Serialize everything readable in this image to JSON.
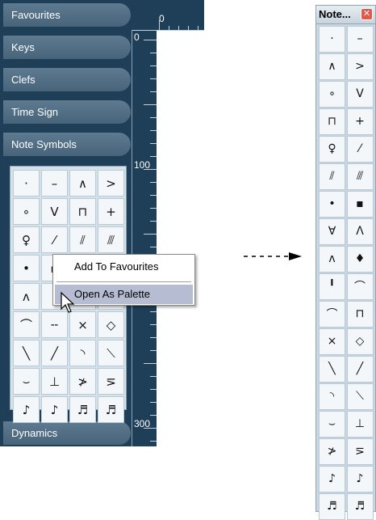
{
  "inspector": {
    "categories": {
      "favourites": "Favourites",
      "keys": "Keys",
      "clefs": "Clefs",
      "time_sign": "Time Sign",
      "note_symbols": "Note Symbols",
      "dynamics": "Dynamics"
    },
    "ruler_labels": {
      "top_zero": "0",
      "left_zero": "0",
      "mark_100": "100",
      "mark_300": "300"
    },
    "symbols": [
      "·",
      "–",
      "∧",
      ">",
      "∘",
      "V",
      "⊓",
      "+",
      "♀",
      "⁄",
      "⫽",
      "⫻",
      "•",
      "▪",
      "",
      "",
      "ʌ",
      "",
      "",
      "",
      "⌒",
      "╌",
      "×",
      "◇",
      "╲",
      "╱",
      "◝",
      "⟍",
      "⌣",
      "⊥",
      "≯",
      "⋝",
      "♪",
      "♪",
      "♬",
      "♬"
    ]
  },
  "context_menu": {
    "items": [
      "Add To Favourites",
      "Open As Palette"
    ],
    "selected_index": 1
  },
  "palette": {
    "title": "Note...",
    "close_label": "✕",
    "symbols": [
      "·",
      "–",
      "∧",
      ">",
      "∘",
      "V",
      "⊓",
      "+",
      "♀",
      "⁄",
      "⫽",
      "⫻",
      "•",
      "▪",
      "∀",
      "Λ",
      "ʌ",
      "♦",
      "╹",
      "⌒",
      "⌒",
      "⊓",
      "×",
      "◇",
      "╲",
      "╱",
      "◝",
      "⟍",
      "⌣",
      "⊥",
      "≯",
      "⋝",
      "♪",
      "♪",
      "♬",
      "♬"
    ]
  },
  "colors": {
    "panel_bg": "#1f3f58",
    "tab_bg": "#4f6c83",
    "menu_selected": "#b6bdd2",
    "close_button": "#e2584a"
  }
}
